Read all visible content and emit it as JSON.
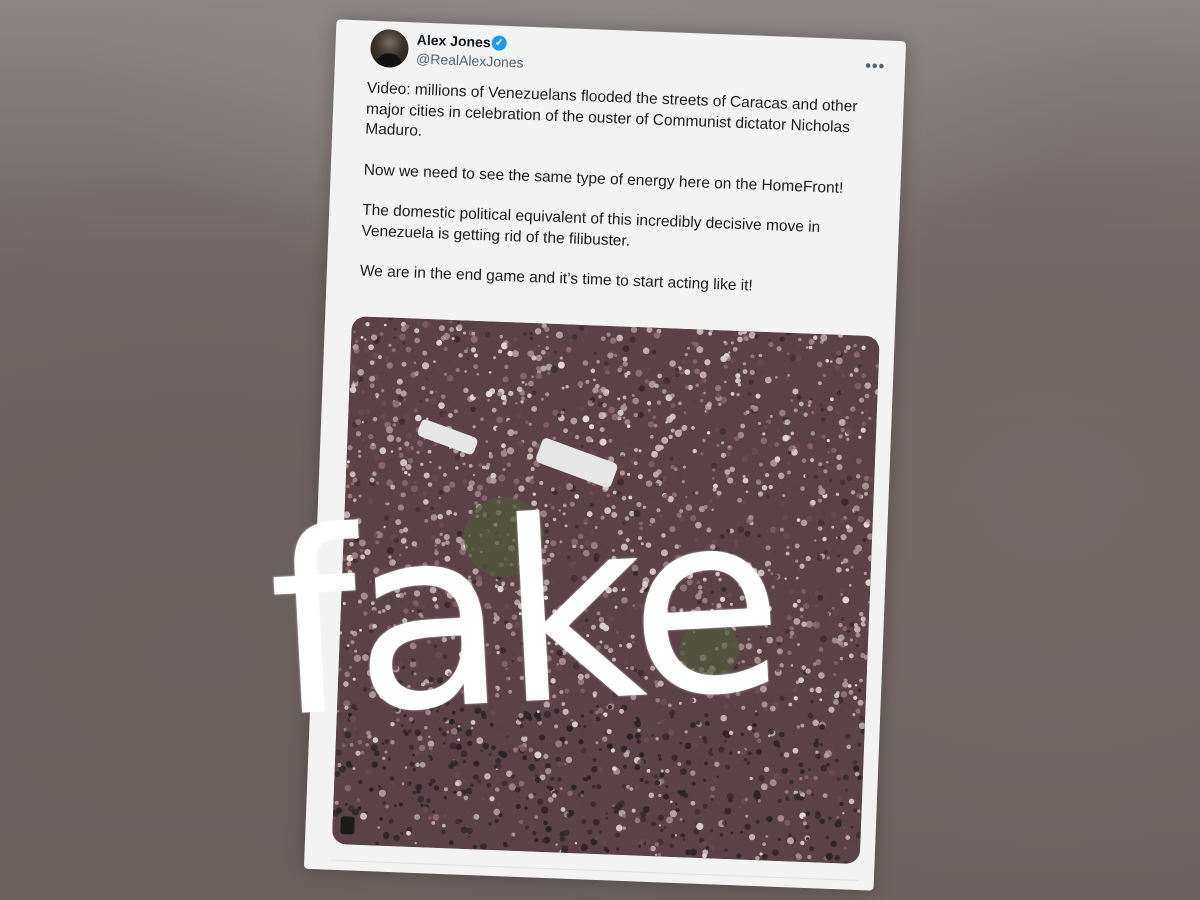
{
  "tweet": {
    "author_name": "Alex Jones",
    "author_handle": "@RealAlexJones",
    "verified_icon": "verified-badge-icon",
    "more_label": "•••",
    "paragraphs": [
      "Video: millions of Venezuelans flooded the streets of Caracas and other major cities in celebration of the ouster of Communist dictator Nicholas Maduro.",
      "Now we need to see the same type of energy here on the HomeFront!",
      "The domestic political equivalent of this incredibly decisive move in Venezuela is getting rid of the filibuster.",
      "We are in the end game and it’s time to start acting like it!"
    ],
    "media_description_icon": "video-play-icon"
  },
  "overlay": {
    "stamp_text": "fake"
  },
  "colors": {
    "verified_blue": "#1d9bf0",
    "stamp_white": "#ffffff",
    "card_background": "#f3f3f3"
  }
}
